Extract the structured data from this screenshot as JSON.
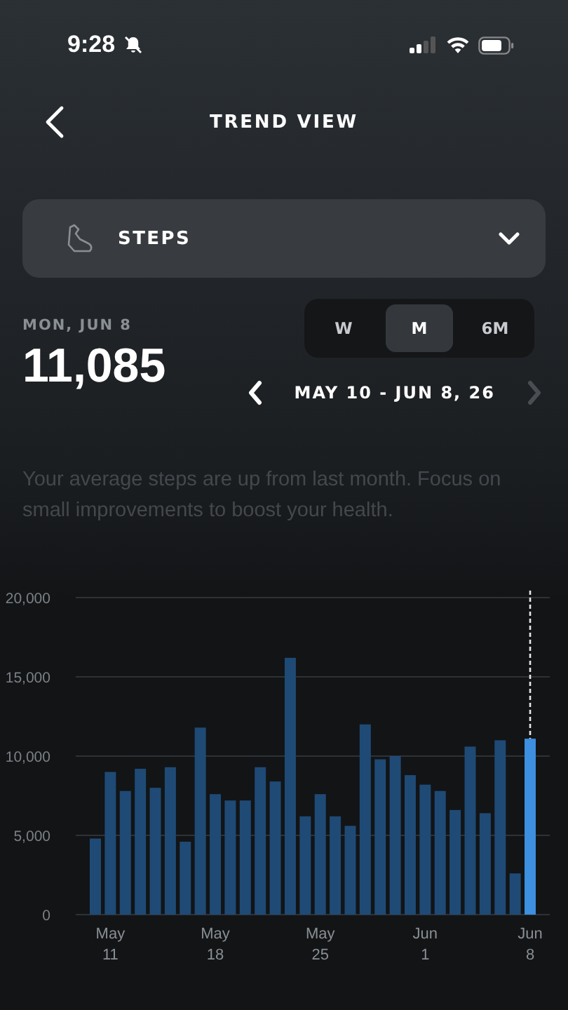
{
  "status_bar": {
    "time": "9:28"
  },
  "header": {
    "title": "TREND VIEW"
  },
  "metric_dropdown": {
    "label": "STEPS"
  },
  "summary": {
    "date": "MON, JUN 8",
    "value": "11,085"
  },
  "period_tabs": [
    {
      "label": "W",
      "selected": false
    },
    {
      "label": "M",
      "selected": true
    },
    {
      "label": "6M",
      "selected": false
    }
  ],
  "range": {
    "label": "MAY 10 - JUN 8, 26",
    "next_disabled": true
  },
  "insight": "Your average steps are up from last month. Focus on small improvements to boost your health.",
  "chart": {
    "chart_data": {
      "type": "bar",
      "grid": true,
      "categories": [
        null,
        "May 11",
        null,
        null,
        null,
        null,
        null,
        null,
        "May 18",
        null,
        null,
        null,
        null,
        null,
        null,
        "May 25",
        null,
        null,
        null,
        null,
        null,
        null,
        "Jun 1",
        null,
        null,
        null,
        null,
        null,
        null,
        "Jun 8"
      ],
      "series": [
        {
          "color": "#1f4a75",
          "values": [
            4800,
            9000,
            7800,
            9200,
            8000,
            9300,
            4600,
            11800,
            7600,
            7200,
            7200,
            9300,
            8400,
            16200,
            6200,
            7600,
            6200,
            5600,
            12000,
            9800,
            10000,
            8800,
            8200,
            7800,
            6600,
            10600,
            6400,
            11000,
            2600,
            null
          ]
        },
        {
          "color": "#3d8fe0",
          "values": [
            null,
            null,
            null,
            null,
            null,
            null,
            null,
            null,
            null,
            null,
            null,
            null,
            null,
            null,
            null,
            null,
            null,
            null,
            null,
            null,
            null,
            null,
            null,
            null,
            null,
            null,
            null,
            null,
            null,
            11100
          ]
        }
      ],
      "ylim": [
        0,
        20000
      ],
      "yticks": [
        {
          "value": 0,
          "label": "0"
        },
        {
          "value": 5000,
          "label": "5,000"
        },
        {
          "value": 10000,
          "label": "10,000"
        },
        {
          "value": 15000,
          "label": "15,000"
        },
        {
          "value": 20000,
          "label": "20,000"
        }
      ]
    }
  }
}
